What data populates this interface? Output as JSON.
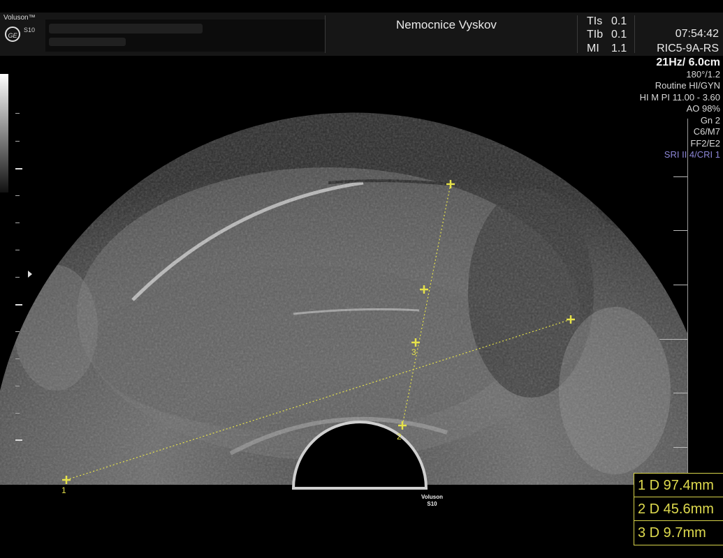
{
  "header": {
    "brand": "Voluson™",
    "model": "S10",
    "logo": "GE",
    "hospital": "Nemocnice Vyskov",
    "indices": [
      {
        "label": "TIs",
        "value": "0.1"
      },
      {
        "label": "TIb",
        "value": "0.1"
      },
      {
        "label": "MI",
        "value": "1.1"
      }
    ],
    "time": "07:54:42",
    "probe": "RIC5-9A-RS"
  },
  "params": {
    "frame_depth": "21Hz/ 6.0cm",
    "angle": "180°/1.2",
    "preset": "Routine HI/GYN",
    "harmonic": "HI M PI 11.00 - 3.60",
    "ao": "AO 98%",
    "gain": "Gn  2",
    "color_map": "C6/M7",
    "ff": "FF2/E2",
    "sri": "SRI II 4/CRI 1"
  },
  "markers": {
    "m1": "1",
    "m2": "2",
    "m3": "3"
  },
  "footer_logo": {
    "brand": "Voluson",
    "model": "S10"
  },
  "measurements": [
    {
      "text": "1 D 97.4mm"
    },
    {
      "text": "2 D 45.6mm"
    },
    {
      "text": "3 D   9.7mm"
    }
  ],
  "colors": {
    "caliper": "#e6e24a",
    "sri": "#8c86d6"
  }
}
